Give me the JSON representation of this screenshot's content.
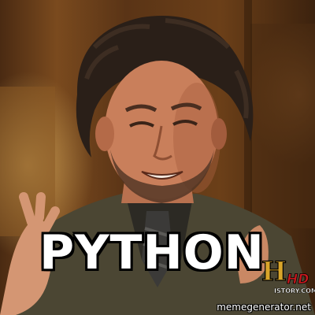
{
  "meme": {
    "caption": "PYTHON",
    "watermark": "memegenerator.net"
  },
  "logo": {
    "letter": "H",
    "hd": "HD",
    "wordmark": "ISTORY.COM"
  },
  "colors": {
    "caption_fill": "#ffffff",
    "caption_stroke": "#000000",
    "logo_gold": "#d9a52a",
    "logo_red": "#c8191e"
  }
}
